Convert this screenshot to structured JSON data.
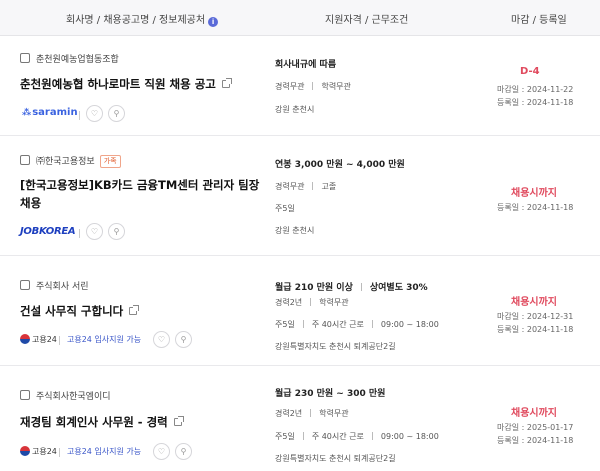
{
  "header": {
    "col1": "회사명 / 채용공고명 / 정보제공처",
    "col2": "지원자격 / 근무조건",
    "col3": "마감 / 등록일"
  },
  "icons": {
    "info": "info-icon",
    "external": "external-link-icon",
    "heart": "heart-icon",
    "search": "search-icon"
  },
  "colors": {
    "accent": "#5a6ad8",
    "deadline": "#e04a5e",
    "badge": "#e05a2a"
  },
  "jobs": [
    {
      "company": "춘천원예농업협동조합",
      "badge": "",
      "title": "춘천원예농협 하나로마트 직원 채용 공고",
      "title2": "",
      "source": "saramin",
      "source_text": "",
      "lead": "회사내규에 따름",
      "bonus": "",
      "tags1": [
        "경력무관",
        "학력무관"
      ],
      "tags2": [],
      "location": "강원 춘천시",
      "deadline": "D-4",
      "deadline_date": "마감일 : 2024-11-22",
      "registered": "등록일 : 2024-11-18"
    },
    {
      "company": "㈜한국고용정보",
      "badge": "가족",
      "title": "[한국고용정보]KB카드 금융TM센터 관리자 팀장",
      "title2": "채용",
      "source": "JOBKOREA",
      "source_text": "",
      "lead": "연봉 3,000 만원 ~ 4,000 만원",
      "bonus": "",
      "tags1": [
        "경력무관",
        "고졸"
      ],
      "tags2": [
        "주5일"
      ],
      "location": "강원 춘천시",
      "deadline": "채용시까지",
      "deadline_date": "",
      "registered": "등록일 : 2024-11-18"
    },
    {
      "company": "주식회사 서린",
      "badge": "",
      "title": "건설 사무직 구합니다",
      "title2": "",
      "source": "고용24",
      "source_text": "고용24 입사지원 가능",
      "lead": "월급 210 만원 이상",
      "bonus": "상여별도 30%",
      "tags1": [
        "경력2년",
        "학력무관"
      ],
      "tags2": [
        "주5일",
        "주 40시간 근로",
        "09:00 ~ 18:00"
      ],
      "location": "강원특별자치도 춘천시 퇴계공단2길",
      "deadline": "채용시까지",
      "deadline_date": "마감일 : 2024-12-31",
      "registered": "등록일 : 2024-11-18"
    },
    {
      "company": "주식회사한국엠이디",
      "badge": "",
      "title": "재경팀 회계인사 사무원 - 경력",
      "title2": "",
      "source": "고용24",
      "source_text": "고용24 입사지원 가능",
      "lead": "월급 230 만원 ~ 300 만원",
      "bonus": "",
      "tags1": [
        "경력2년",
        "학력무관"
      ],
      "tags2": [
        "주5일",
        "주 40시간 근로",
        "09:00 ~ 18:00"
      ],
      "location": "강원특별자치도 춘천시 퇴계공단2길",
      "deadline": "채용시까지",
      "deadline_date": "마감일 : 2025-01-17",
      "registered": "등록일 : 2024-11-18"
    }
  ]
}
